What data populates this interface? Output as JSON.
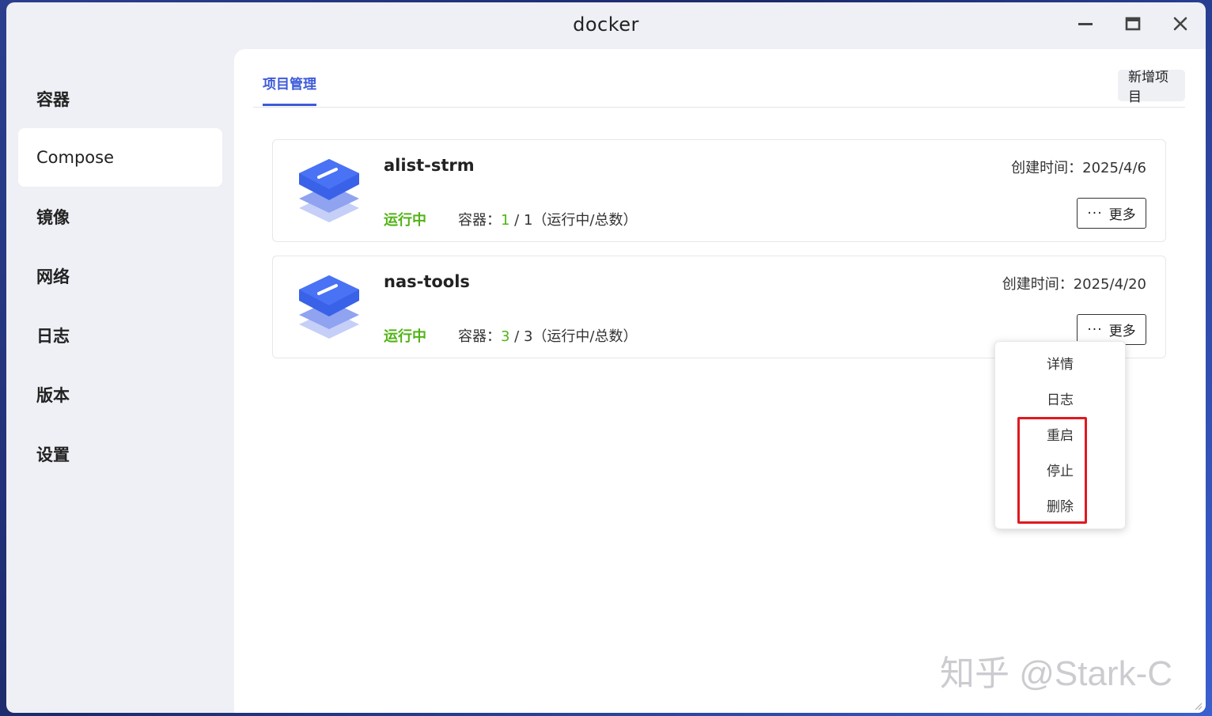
{
  "window": {
    "title": "docker"
  },
  "sidebar": {
    "items": [
      {
        "label": "容器"
      },
      {
        "label": "Compose"
      },
      {
        "label": "镜像"
      },
      {
        "label": "网络"
      },
      {
        "label": "日志"
      },
      {
        "label": "版本"
      },
      {
        "label": "设置"
      }
    ],
    "active": "Compose"
  },
  "main": {
    "tab_label": "项目管理",
    "add_button": "新增项目"
  },
  "projects": [
    {
      "name": "alist-strm",
      "status": "运行中",
      "containers_label": "容器：",
      "running": "1",
      "total_text": " / 1（运行中/总数）",
      "created": "创建时间：2025/4/6",
      "more_label": "更多"
    },
    {
      "name": "nas-tools",
      "status": "运行中",
      "containers_label": "容器：",
      "running": "3",
      "total_text": " / 3（运行中/总数）",
      "created": "创建时间：2025/4/20",
      "more_label": "更多"
    }
  ],
  "more_menu": {
    "items": [
      {
        "label": "详情"
      },
      {
        "label": "日志"
      },
      {
        "label": "重启"
      },
      {
        "label": "停止"
      },
      {
        "label": "删除"
      }
    ]
  },
  "watermark": "知乎 @Stark-C",
  "colors": {
    "accent": "#3d5bd9",
    "running": "#52b316",
    "highlight": "#e0191f"
  }
}
